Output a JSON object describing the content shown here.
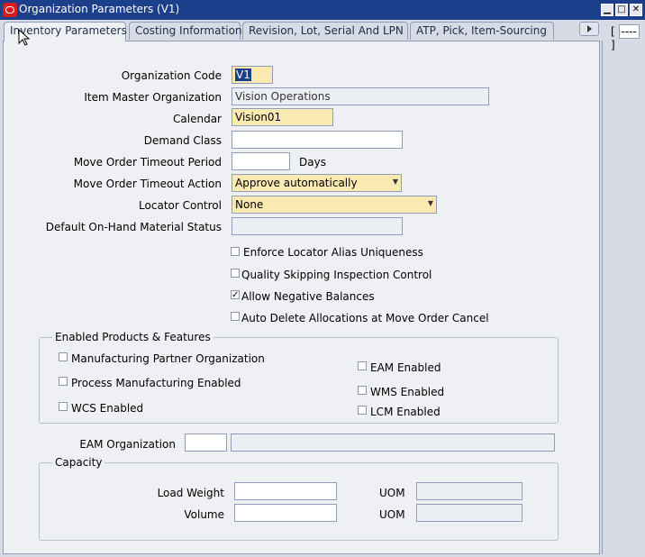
{
  "window": {
    "title": "Organization Parameters (V1)",
    "controls": {
      "minimize": "▁",
      "maximize": "□",
      "close": "✕"
    }
  },
  "tabs": [
    {
      "label": "Inventory Parameters",
      "active": true
    },
    {
      "label": "Costing Information"
    },
    {
      "label": "Revision, Lot, Serial And LPN"
    },
    {
      "label": "ATP, Pick, Item-Sourcing"
    }
  ],
  "tab_scroll_icon": "right-arrow-icon",
  "tab_extra": "----",
  "form": {
    "organization_code": {
      "label": "Organization Code",
      "value": "V1"
    },
    "item_master_org": {
      "label": "Item Master Organization",
      "value": "Vision Operations"
    },
    "calendar": {
      "label": "Calendar",
      "value": "Vision01"
    },
    "demand_class": {
      "label": "Demand Class",
      "value": ""
    },
    "move_order_timeout_period": {
      "label": "Move Order Timeout Period",
      "value": "",
      "unit": "Days"
    },
    "move_order_timeout_action": {
      "label": "Move Order Timeout Action",
      "value": "Approve automatically"
    },
    "locator_control": {
      "label": "Locator Control",
      "value": "None"
    },
    "default_onhand_status": {
      "label": "Default On-Hand Material Status",
      "value": ""
    }
  },
  "checkboxes": [
    {
      "label": "Enforce Locator Alias Uniqueness",
      "checked": false
    },
    {
      "label": "Quality Skipping Inspection Control",
      "checked": false
    },
    {
      "label": "Allow Negative Balances",
      "checked": true
    },
    {
      "label": "Auto Delete Allocations at Move Order Cancel",
      "checked": false
    }
  ],
  "enabled_products": {
    "title": "Enabled Products & Features",
    "left": [
      {
        "label": "Manufacturing Partner Organization",
        "checked": false
      },
      {
        "label": "Process Manufacturing Enabled",
        "checked": false
      },
      {
        "label": "WCS Enabled",
        "checked": false
      }
    ],
    "right": [
      {
        "label": "EAM Enabled",
        "checked": false
      },
      {
        "label": "WMS Enabled",
        "checked": false
      },
      {
        "label": "LCM Enabled",
        "checked": false
      }
    ]
  },
  "eam_organization": {
    "label": "EAM Organization",
    "value": "",
    "description": ""
  },
  "capacity": {
    "title": "Capacity",
    "load_weight": {
      "label": "Load Weight",
      "value": "",
      "uom_label": "UOM",
      "uom": ""
    },
    "volume": {
      "label": "Volume",
      "value": "",
      "uom_label": "UOM",
      "uom": ""
    }
  }
}
